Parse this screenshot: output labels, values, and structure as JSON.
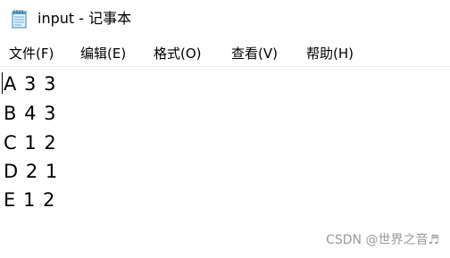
{
  "window": {
    "title": "input - 记事本",
    "icon": "notepad-icon"
  },
  "menu": [
    "文件(F)",
    "编辑(E)",
    "格式(O)",
    "查看(V)",
    "帮助(H)"
  ],
  "editor": {
    "lines": [
      "A 3 3",
      "B 4 3",
      "C 1 2",
      "D 2 1",
      "E 1 2"
    ]
  },
  "watermark": "CSDN @世界之音♬"
}
